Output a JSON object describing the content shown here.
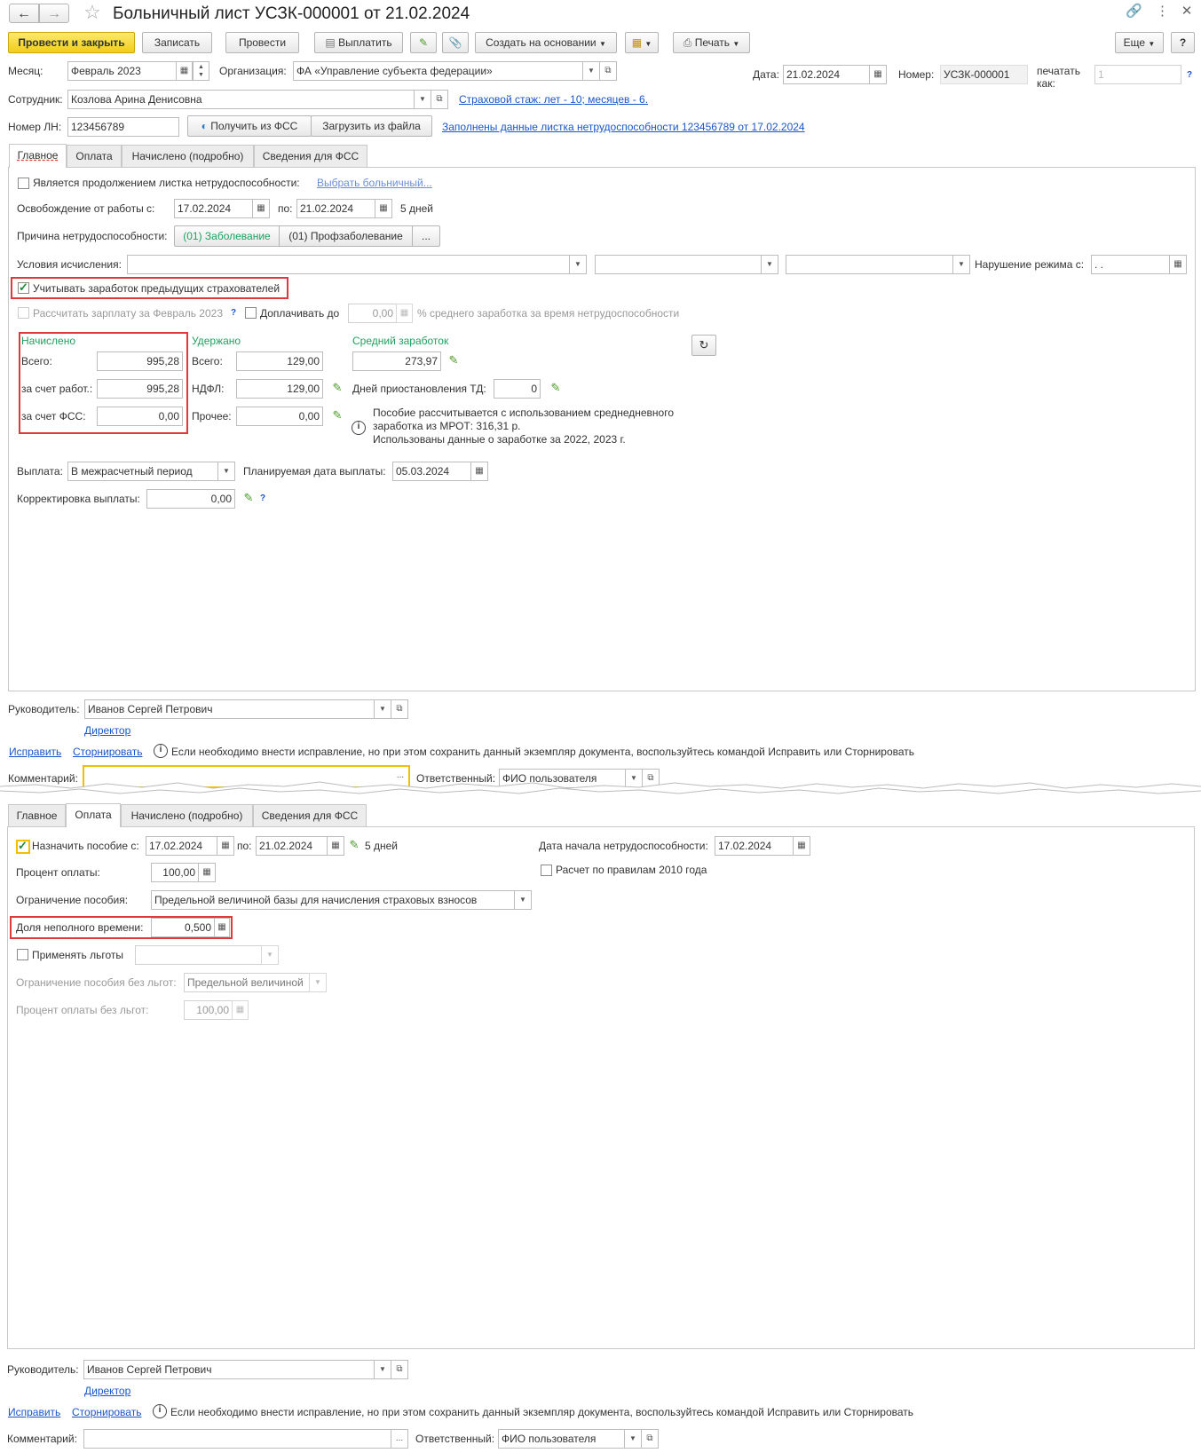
{
  "window": {
    "title": "Больничный лист УСЗК-000001 от 21.02.2024"
  },
  "icons": {
    "back": "arrow-left-icon",
    "forward": "arrow-right-icon",
    "star": "star-icon",
    "link": "link-icon",
    "more": "more-icon",
    "close": "close-icon",
    "calendar": "calendar-icon",
    "dropdown": "chevron-down-icon",
    "open": "open-in-new-icon",
    "pencil": "pencil-icon",
    "refresh": "refresh-icon",
    "info": "info-icon",
    "calculator": "calculator-icon"
  },
  "colors": {
    "primary_button": "#f2cd1a",
    "link": "#1a56c8",
    "highlight_box": "#e0393b",
    "section_green": "#20a060"
  },
  "toolbar": {
    "post_close": "Провести и закрыть",
    "save": "Записать",
    "post": "Провести",
    "pay": "Выплатить",
    "create_based": "Создать на основании",
    "print": "Печать",
    "more": "Еще",
    "help": "?"
  },
  "header": {
    "month_label": "Месяц:",
    "month_value": "Февраль 2023",
    "org_label": "Организация:",
    "org_value": "ФА «Управление субъекта федерации»",
    "date_label": "Дата:",
    "date_value": "21.02.2024",
    "number_label": "Номер:",
    "number_value": "УСЗК-000001",
    "print_as_label": "печатать как:",
    "print_as_value": "1",
    "help": "?",
    "employee_label": "Сотрудник:",
    "employee_value": "Козлова Арина Денисовна",
    "insurance_link": "Страховой стаж: лет - 10; месяцев - 6.",
    "ln_label": "Номер ЛН:",
    "ln_value": "123456789",
    "get_fss": "Получить из ФСС",
    "load_file": "Загрузить из файла",
    "filled_link": "Заполнены данные листка нетрудоспособности 123456789 от 17.02.2024"
  },
  "tabs": {
    "main": "Главное",
    "payment": "Оплата",
    "accrued": "Начислено (подробно)",
    "fss": "Сведения для ФСС"
  },
  "main": {
    "continuation_label": "Является продолжением листка нетрудоспособности:",
    "choose_sick": "Выбрать больничный...",
    "release_label": "Освобождение от работы с:",
    "release_from": "17.02.2024",
    "to_label": "по:",
    "release_to": "21.02.2024",
    "days": "5 дней",
    "reason_label": "Причина нетрудоспособности:",
    "reason1": "(01) Заболевание",
    "reason2": "(01) Профзаболевание",
    "reason_more": "...",
    "conditions_label": "Условия исчисления:",
    "violation_label": "Нарушение режима с:",
    "violation_value": " .  .",
    "prev_insurers": "Учитывать заработок предыдущих страхователей",
    "calc_salary": "Рассчитать зарплату за Февраль 2023",
    "calc_help": "?",
    "pay_up_to": "Доплачивать до",
    "pay_up_value": "0,00",
    "avg_percent": "% среднего заработка за время нетрудоспособности",
    "accrued_header": "Начислено",
    "total_label": "Всего:",
    "accrued_total": "995,28",
    "employer_label": "за счет работ.:",
    "accrued_employer": "995,28",
    "fss_label": "за счет ФСС:",
    "accrued_fss": "0,00",
    "withheld_header": "Удержано",
    "withheld_total_label": "Всего:",
    "withheld_total": "129,00",
    "ndfl_label": "НДФЛ:",
    "withheld_ndfl": "129,00",
    "other_label": "Прочее:",
    "withheld_other": "0,00",
    "avg_header": "Средний заработок",
    "avg_value": "273,97",
    "suspend_label": "Дней приостановления ТД:",
    "suspend_value": "0",
    "info_line1": "Пособие рассчитывается с использованием среднедневного",
    "info_line2": "заработка из МРОТ: 316,31 р.",
    "info_line3": "Использованы данные о заработке за  2022,  2023 г.",
    "payout_label": "Выплата:",
    "payout_value": "В межрасчетный период",
    "plan_date_label": "Планируемая дата выплаты:",
    "plan_date_value": "05.03.2024",
    "correction_label": "Корректировка выплаты:",
    "correction_value": "0,00",
    "correction_help": "?"
  },
  "payment": {
    "assign_label": "Назначить пособие с:",
    "assign_from": "17.02.2024",
    "to_label": "по:",
    "assign_to": "21.02.2024",
    "days": "5 дней",
    "start_label": "Дата начала нетрудоспособности:",
    "start_value": "17.02.2024",
    "rules2010": "Расчет по правилам 2010 года",
    "percent_label": "Процент оплаты:",
    "percent_value": "100,00",
    "limit_label": "Ограничение пособия:",
    "limit_value": "Предельной величиной базы для начисления страховых взносов",
    "part_time_label": "Доля неполного времени:",
    "part_time_value": "0,500",
    "benefits_label": "Применять льготы",
    "limit_nobenefit_label": "Ограничение пособия без льгот:",
    "limit_nobenefit_value": "Предельной величиной",
    "percent_nobenefit_label": "Процент оплаты без льгот:",
    "percent_nobenefit_value": "100,00"
  },
  "footer": {
    "manager_label": "Руководитель:",
    "manager_value": "Иванов Сергей Петрович",
    "position": "Директор",
    "fix": "Исправить",
    "reverse": "Сторнировать",
    "hint": "Если необходимо внести исправление, но при этом сохранить данный экземпляр документа, воспользуйтесь командой Исправить или Сторнировать",
    "comment_label": "Комментарий:",
    "comment_more": "...",
    "responsible_label": "Ответственный:",
    "responsible_value": "ФИО пользователя"
  }
}
